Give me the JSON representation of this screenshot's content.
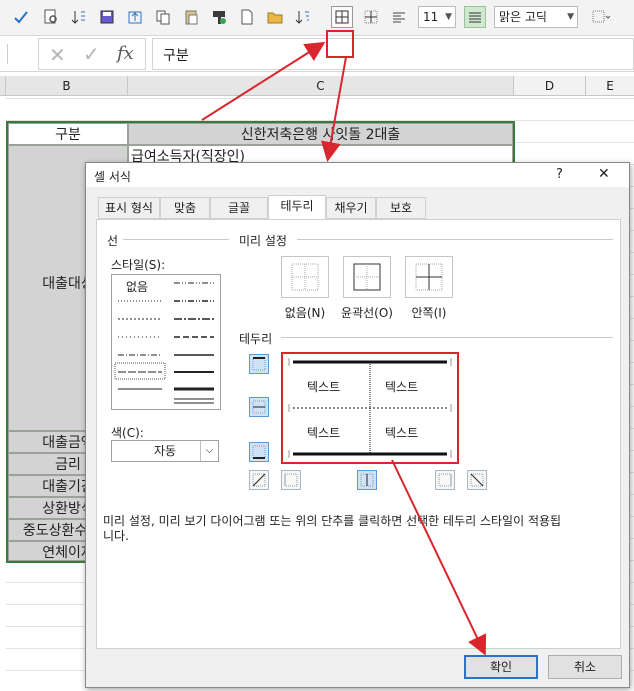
{
  "toolbar": {
    "font_size": "11",
    "font_name": "맑은 고딕"
  },
  "formula_bar": {
    "cell_value": "구분",
    "fx_label": "fx"
  },
  "columns": [
    "B",
    "C",
    "D",
    "E"
  ],
  "sheet": {
    "header_left": "구분",
    "header_right": "신한저축은행 사잇돌 2대출",
    "row_sub": "급여소득자(직장인)",
    "rows": [
      "대출대상",
      "대출금액",
      "금리",
      "대출기간",
      "상환방식",
      "중도상환수수료",
      "연체이자"
    ]
  },
  "dialog": {
    "title": "셀 서식",
    "help": "?",
    "close": "✕",
    "tabs": [
      "표시 형식",
      "맞춤",
      "글꼴",
      "테두리",
      "채우기",
      "보호"
    ],
    "line_group": "선",
    "style_label": "스타일(S):",
    "none_style": "없음",
    "color_label": "색(C):",
    "color_value": "자동",
    "presets_group": "미리 설정",
    "presets": [
      "없음(N)",
      "윤곽선(O)",
      "안쪽(I)"
    ],
    "border_group": "테두리",
    "preview_text": [
      "텍스트",
      "텍스트",
      "텍스트",
      "텍스트"
    ],
    "description": "미리 설정, 미리 보기 다이어그램 또는 위의 단추를 클릭하면 선택한 테두리 스타일이 적용됩니다.",
    "ok": "확인",
    "cancel": "취소"
  },
  "colors": {
    "annotation": "#d9262c",
    "sheet_border": "#3b7a3b",
    "header_fill": "#d3d3d3"
  }
}
